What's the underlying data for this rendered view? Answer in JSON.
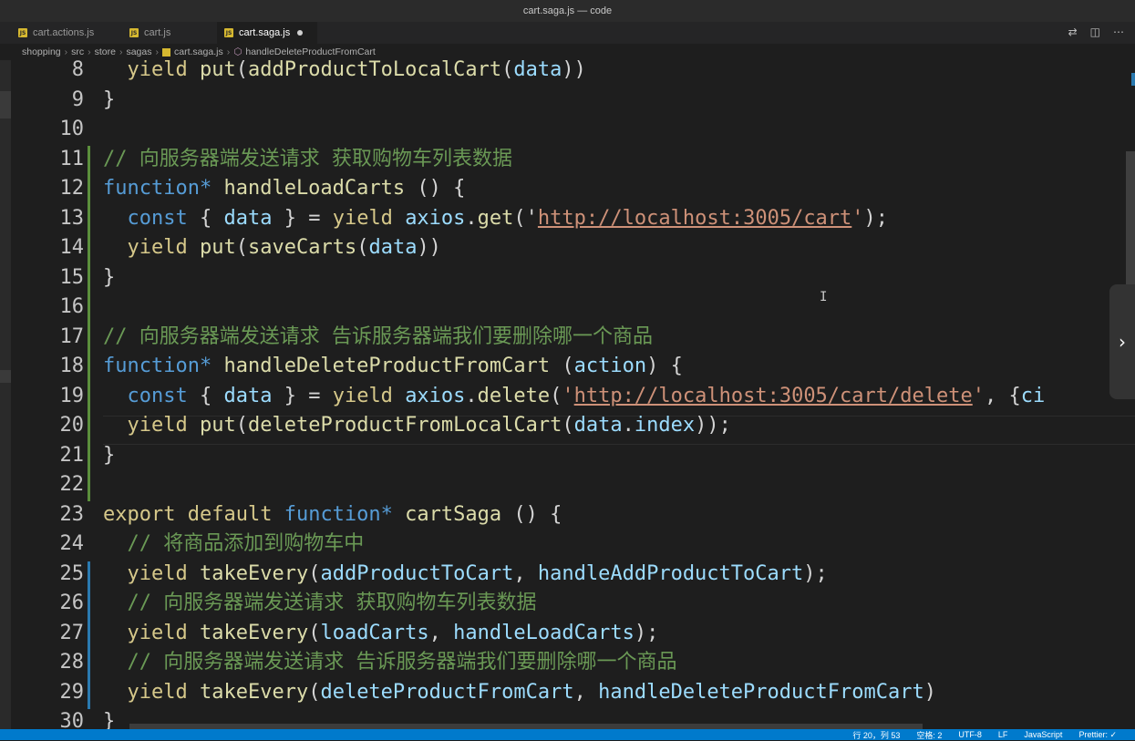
{
  "window": {
    "title": "cart.saga.js — code"
  },
  "tabs": [
    {
      "label": "cart.actions.js",
      "active": false
    },
    {
      "label": "cart.js",
      "active": false
    },
    {
      "label": "cart.saga.js",
      "active": true,
      "modified": true
    }
  ],
  "breadcrumb": [
    "shopping",
    "src",
    "store",
    "sagas",
    "cart.saga.js",
    "handleDeleteProductFromCart"
  ],
  "editor": {
    "line_numbers": [
      "8",
      "9",
      "10",
      "11",
      "12",
      "13",
      "14",
      "15",
      "16",
      "17",
      "18",
      "19",
      "20",
      "21",
      "22",
      "23",
      "24",
      "25",
      "26",
      "27",
      "28",
      "29",
      "30"
    ],
    "lines": [
      [
        {
          "t": "  "
        },
        {
          "t": "yield",
          "c": "ky"
        },
        {
          "t": " "
        },
        {
          "t": "put",
          "c": "f"
        },
        {
          "t": "("
        },
        {
          "t": "addProductToLocalCart",
          "c": "f"
        },
        {
          "t": "("
        },
        {
          "t": "data",
          "c": "v"
        },
        {
          "t": "))"
        }
      ],
      [
        {
          "t": "}"
        }
      ],
      [],
      [
        {
          "t": "// 向服务器端发送请求 获取购物车列表数据",
          "c": "c"
        }
      ],
      [
        {
          "t": "function*",
          "c": "k"
        },
        {
          "t": " "
        },
        {
          "t": "handleLoadCarts",
          "c": "f"
        },
        {
          "t": " () {"
        }
      ],
      [
        {
          "t": "  "
        },
        {
          "t": "const",
          "c": "k"
        },
        {
          "t": " { "
        },
        {
          "t": "data",
          "c": "v"
        },
        {
          "t": " } = "
        },
        {
          "t": "yield",
          "c": "ky"
        },
        {
          "t": " "
        },
        {
          "t": "axios",
          "c": "v"
        },
        {
          "t": "."
        },
        {
          "t": "get",
          "c": "f"
        },
        {
          "t": "("
        },
        {
          "t": "'"
        },
        {
          "t": "http://localhost:3005/cart",
          "c": "s",
          "u": true
        },
        {
          "t": "'",
          "c": "s"
        },
        {
          "t": ");"
        }
      ],
      [
        {
          "t": "  "
        },
        {
          "t": "yield",
          "c": "ky"
        },
        {
          "t": " "
        },
        {
          "t": "put",
          "c": "f"
        },
        {
          "t": "("
        },
        {
          "t": "saveCarts",
          "c": "f"
        },
        {
          "t": "("
        },
        {
          "t": "data",
          "c": "v"
        },
        {
          "t": "))"
        }
      ],
      [
        {
          "t": "}"
        }
      ],
      [],
      [
        {
          "t": "// 向服务器端发送请求 告诉服务器端我们要删除哪一个商品",
          "c": "c"
        }
      ],
      [
        {
          "t": "function*",
          "c": "k"
        },
        {
          "t": " "
        },
        {
          "t": "handleDeleteProductFromCart",
          "c": "f"
        },
        {
          "t": " ("
        },
        {
          "t": "action",
          "c": "v"
        },
        {
          "t": ") {"
        }
      ],
      [
        {
          "t": "  "
        },
        {
          "t": "const",
          "c": "k"
        },
        {
          "t": " { "
        },
        {
          "t": "data",
          "c": "v"
        },
        {
          "t": " } = "
        },
        {
          "t": "yield",
          "c": "ky"
        },
        {
          "t": " "
        },
        {
          "t": "axios",
          "c": "v"
        },
        {
          "t": "."
        },
        {
          "t": "delete",
          "c": "f"
        },
        {
          "t": "("
        },
        {
          "t": "'",
          "c": "s"
        },
        {
          "t": "http://localhost:3005/cart/delete",
          "c": "s",
          "u": true
        },
        {
          "t": "'",
          "c": "s"
        },
        {
          "t": ", {"
        },
        {
          "t": "ci",
          "c": "v"
        }
      ],
      [
        {
          "t": "  "
        },
        {
          "t": "yield",
          "c": "ky"
        },
        {
          "t": " "
        },
        {
          "t": "put",
          "c": "f"
        },
        {
          "t": "("
        },
        {
          "t": "deleteProductFromLocalCart",
          "c": "f"
        },
        {
          "t": "("
        },
        {
          "t": "data",
          "c": "v"
        },
        {
          "t": "."
        },
        {
          "t": "index",
          "c": "v"
        },
        {
          "t": "));"
        }
      ],
      [
        {
          "t": "}"
        }
      ],
      [],
      [
        {
          "t": "export",
          "c": "ky"
        },
        {
          "t": " "
        },
        {
          "t": "default",
          "c": "ky"
        },
        {
          "t": " "
        },
        {
          "t": "function*",
          "c": "k"
        },
        {
          "t": " "
        },
        {
          "t": "cartSaga",
          "c": "f"
        },
        {
          "t": " () {"
        }
      ],
      [
        {
          "t": "  "
        },
        {
          "t": "// 将商品添加到购物车中",
          "c": "c"
        }
      ],
      [
        {
          "t": "  "
        },
        {
          "t": "yield",
          "c": "ky"
        },
        {
          "t": " "
        },
        {
          "t": "takeEvery",
          "c": "f"
        },
        {
          "t": "("
        },
        {
          "t": "addProductToCart",
          "c": "v"
        },
        {
          "t": ", "
        },
        {
          "t": "handleAddProductToCart",
          "c": "v"
        },
        {
          "t": ");"
        }
      ],
      [
        {
          "t": "  "
        },
        {
          "t": "// 向服务器端发送请求 获取购物车列表数据",
          "c": "c"
        }
      ],
      [
        {
          "t": "  "
        },
        {
          "t": "yield",
          "c": "ky"
        },
        {
          "t": " "
        },
        {
          "t": "takeEvery",
          "c": "f"
        },
        {
          "t": "("
        },
        {
          "t": "loadCarts",
          "c": "v"
        },
        {
          "t": ", "
        },
        {
          "t": "handleLoadCarts",
          "c": "v"
        },
        {
          "t": ");"
        }
      ],
      [
        {
          "t": "  "
        },
        {
          "t": "// 向服务器端发送请求 告诉服务器端我们要删除哪一个商品",
          "c": "c"
        }
      ],
      [
        {
          "t": "  "
        },
        {
          "t": "yield",
          "c": "ky"
        },
        {
          "t": " "
        },
        {
          "t": "takeEvery",
          "c": "f"
        },
        {
          "t": "("
        },
        {
          "t": "deleteProductFromCart",
          "c": "v"
        },
        {
          "t": ", "
        },
        {
          "t": "handleDeleteProductFromCart",
          "c": "v"
        },
        {
          "t": ")"
        }
      ],
      [
        {
          "t": "}"
        }
      ]
    ]
  },
  "statusbar": {
    "items": [
      "行 20，列 53",
      "空格: 2",
      "UTF-8",
      "LF",
      "JavaScript",
      "Prettier: ✓"
    ]
  },
  "colors": {
    "editor_bg": "#1e1e1e",
    "keyword": "#569cd6",
    "function": "#dcdcaa",
    "string": "#ce9178",
    "comment": "#6a9955",
    "statusbar": "#007acc"
  }
}
